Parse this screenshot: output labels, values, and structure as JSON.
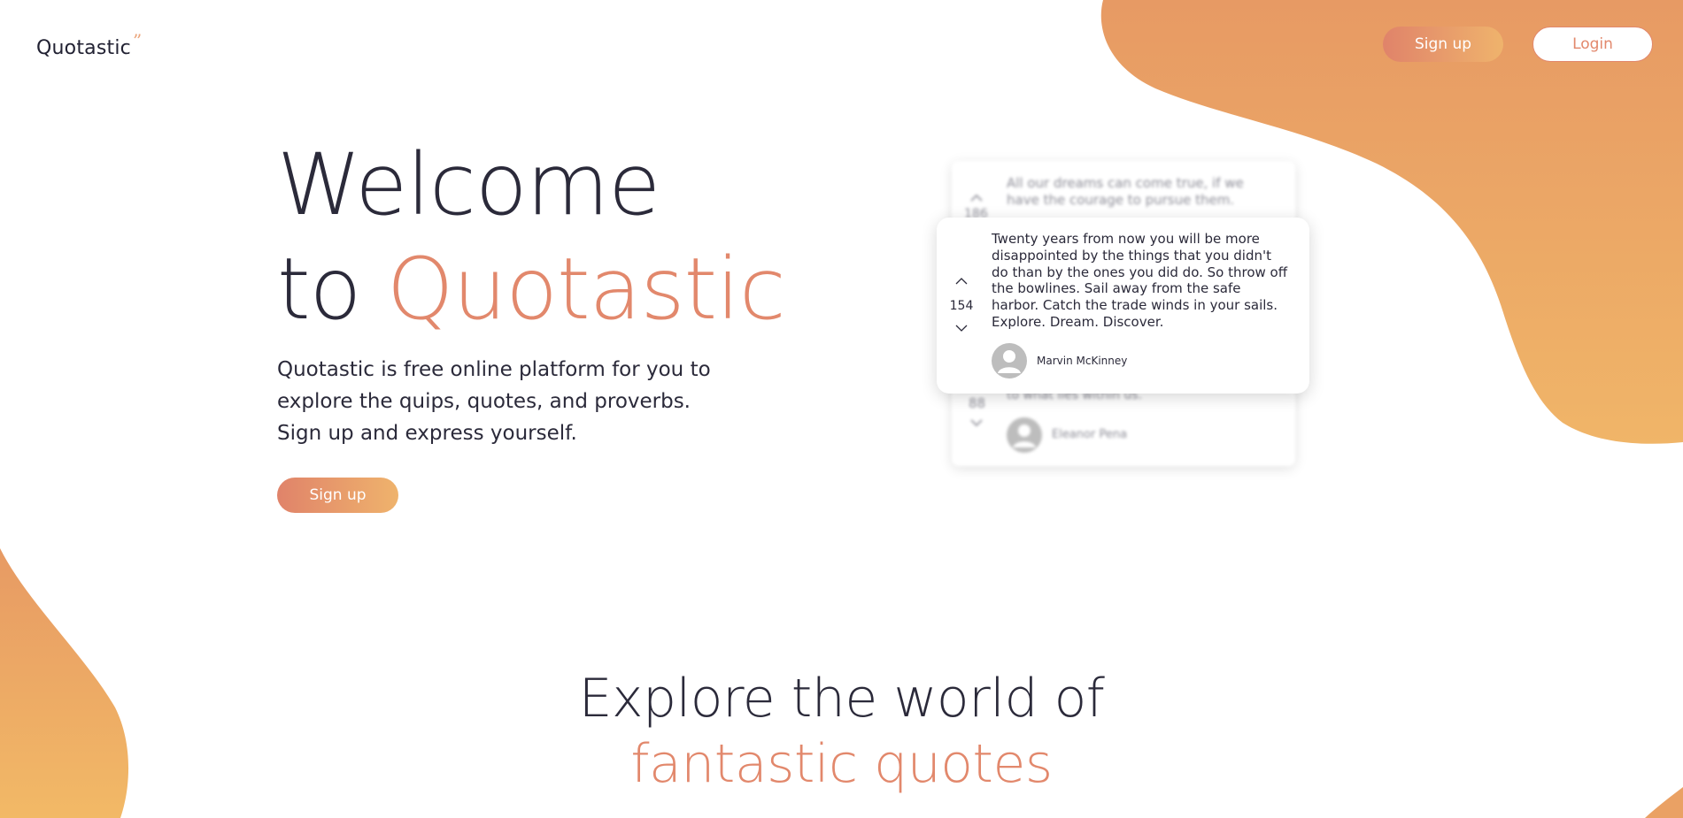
{
  "header": {
    "logo_text": "Quotastic",
    "logo_mark": "”",
    "signup_label": "Sign up",
    "login_label": "Login"
  },
  "hero": {
    "title_line1": "Welcome",
    "title_line2_prefix": "to",
    "title_line2_accent": "Quotastic",
    "description": "Quotastic is free online platform for you to explore the quips, quotes, and proverbs. Sign up and express yourself.",
    "signup_label": "Sign up"
  },
  "quote_stack": {
    "back_top": {
      "text": "All our dreams can come true, if we have the courage to pursue them.",
      "votes": "186"
    },
    "front": {
      "text": "Twenty years from now you will be more disappointed by the things that you didn't do than by the ones you did do. So throw off the bowlines. Sail away from the safe harbor. Catch the trade winds in your sails. Explore. Dream. Discover.",
      "votes": "154",
      "author": "Marvin McKinney"
    },
    "back_bottom": {
      "text": "to what lies within us.",
      "votes": "88",
      "author": "Eleanor Pena"
    }
  },
  "explore": {
    "title_line1": "Explore the world of",
    "title_line2": "fantastic quotes"
  },
  "colors": {
    "accent": "#e2886c",
    "gradient_start": "#e0836a",
    "gradient_end": "#efb36c",
    "text_dark": "#2b2a3a"
  },
  "icons": {
    "vote_up": "chevron-up-icon",
    "vote_down": "chevron-down-icon",
    "avatar": "user-avatar-icon",
    "logo_mark": "quote-mark-icon"
  }
}
